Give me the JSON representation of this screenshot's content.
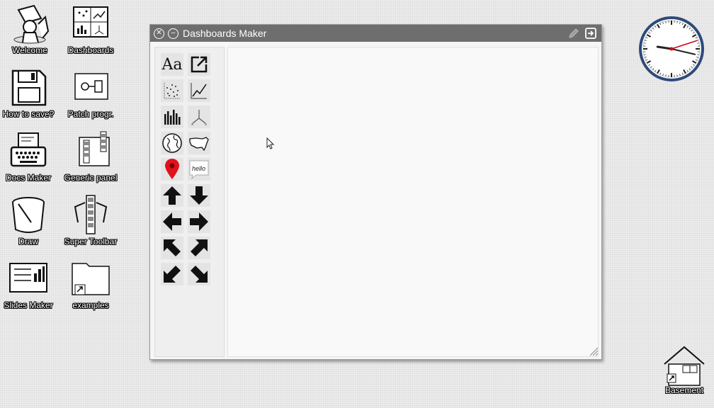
{
  "desktop": {
    "icons": [
      {
        "label": "Welcome",
        "icon": "welcome-figure-icon"
      },
      {
        "label": "Dashboards",
        "icon": "dashboards-icon"
      },
      {
        "label": "How to save?",
        "icon": "floppy-disk-icon"
      },
      {
        "label": "Patch progr.",
        "icon": "patch-icon"
      },
      {
        "label": "Docs Maker",
        "icon": "typewriter-icon"
      },
      {
        "label": "Generic panel",
        "icon": "generic-panel-icon"
      },
      {
        "label": "Draw",
        "icon": "paint-bucket-icon"
      },
      {
        "label": "Super Toolbar",
        "icon": "super-toolbar-icon"
      },
      {
        "label": "Slides Maker",
        "icon": "slides-icon"
      },
      {
        "label": "examples",
        "icon": "folder-icon"
      },
      {
        "label": "Basement",
        "icon": "basement-house-icon"
      }
    ]
  },
  "window": {
    "title": "Dashboards Maker",
    "palette": {
      "text_tool_label": "Aa",
      "speech_bubble_text": "hello"
    }
  },
  "colors": {
    "titlebar": "#6e6e6e",
    "clock_ring": "#2e4a7a",
    "second_hand": "#d0021b",
    "map_pin": "#e0121a"
  },
  "clock": {
    "hour": 9,
    "minute": 17,
    "second": 12
  }
}
